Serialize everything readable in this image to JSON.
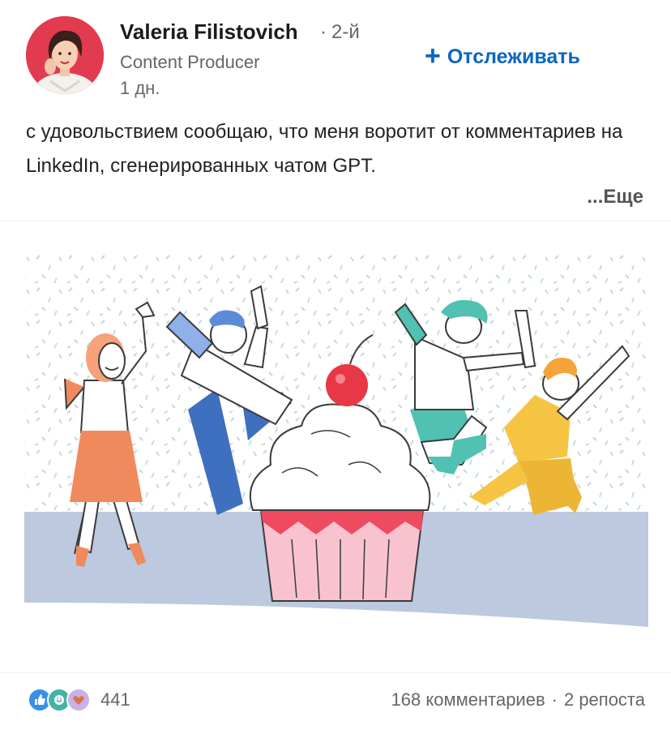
{
  "post": {
    "author": {
      "name": "Valeria Filistovich",
      "degree": "2-й",
      "headline": "Content Producer",
      "time": "1 дн."
    },
    "follow_label": "Отслеживать",
    "text": "с удовольствием сообщаю, что меня воротит от комментариев на LinkedIn, сгенерированных чатом GPT.",
    "more_label": "...Еще"
  },
  "social": {
    "reaction_icons": [
      "like-icon",
      "celebrate-icon",
      "love-icon"
    ],
    "reactions_count": "441",
    "comments": "168 комментариев",
    "separator": "·",
    "reposts": "2 репоста"
  },
  "colors": {
    "accent": "#0a66c2",
    "avatar_bg": "#e23b4f",
    "like": "#378fe9",
    "celebrate": "#44b3a7",
    "love": "#c7b3e6"
  }
}
